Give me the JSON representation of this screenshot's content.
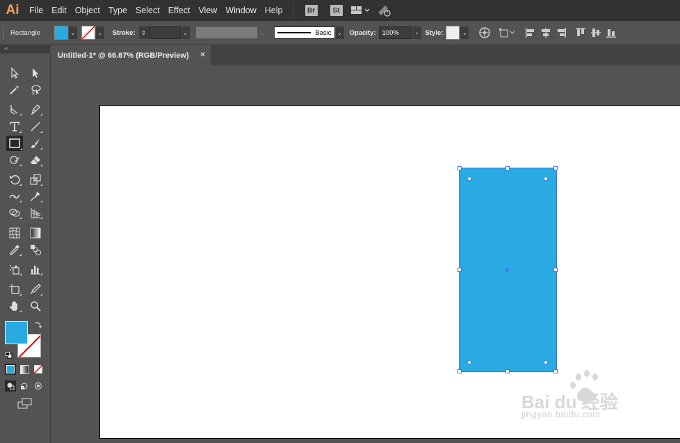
{
  "app": {
    "logo": "Ai",
    "colors": {
      "accent": "#29abe2",
      "selection": "#4a6ff0",
      "logo": "#f6a24f"
    }
  },
  "menu": {
    "items": [
      "File",
      "Edit",
      "Object",
      "Type",
      "Select",
      "Effect",
      "View",
      "Window",
      "Help"
    ],
    "badges": [
      "Br",
      "St"
    ]
  },
  "control_bar": {
    "tool_name": "Rectangle",
    "stroke_label": "Stroke:",
    "stroke_style": "Basic",
    "opacity_label": "Opacity:",
    "opacity_value": "100%",
    "style_label": "Style:"
  },
  "document": {
    "tab_title": "Untitled-1* @ 66.67% (RGB/Preview)",
    "close_glyph": "×"
  },
  "tools": {
    "collapse_glyph": "‹‹"
  },
  "watermark": {
    "logo_text": "Bai du 经验",
    "url": "jingyan.baidu.com"
  }
}
